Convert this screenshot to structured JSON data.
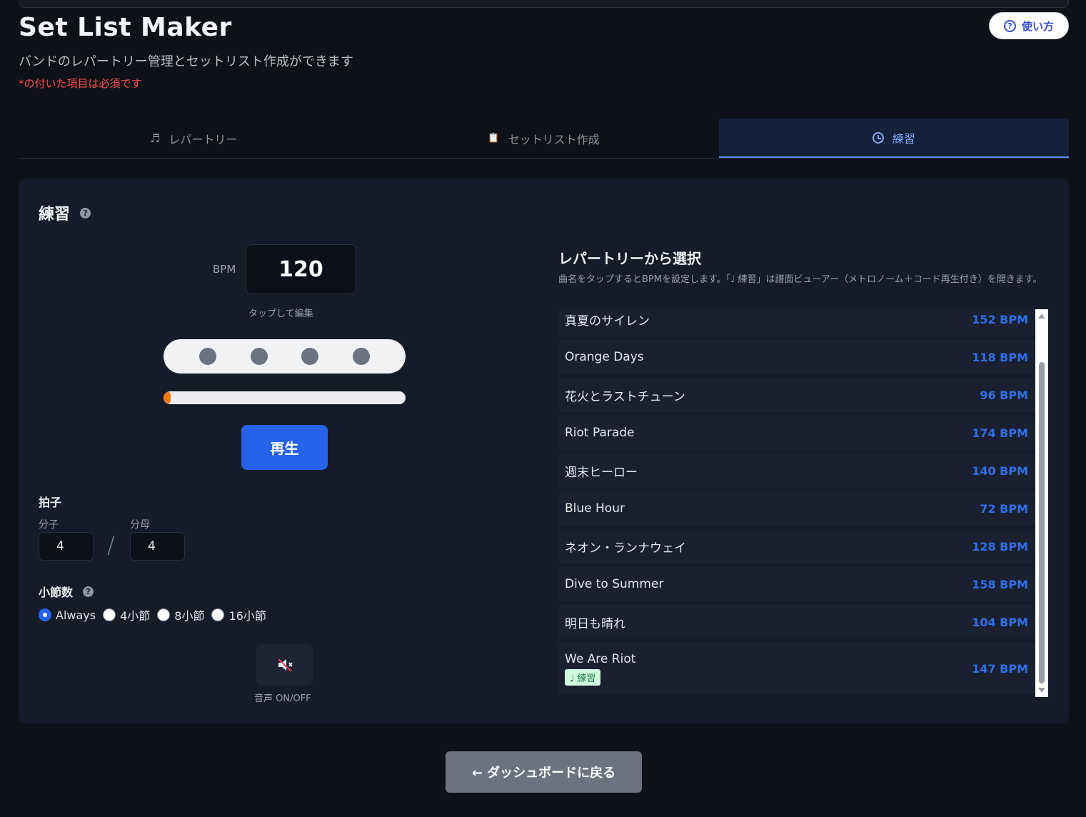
{
  "header": {
    "title": "Set List Maker",
    "subtitle": "バンドのレパートリー管理とセットリスト作成ができます",
    "required_note": "*の付いた項目は必須です",
    "help_button": "使い方",
    "help_icon": "?"
  },
  "tabs": [
    {
      "label": "レパートリー",
      "icon": "music-note-icon",
      "glyph": "♬",
      "active": false
    },
    {
      "label": "セットリスト作成",
      "icon": "clipboard-icon",
      "glyph": "📋",
      "active": false
    },
    {
      "label": "練習",
      "icon": "clock-icon",
      "active": true
    }
  ],
  "practice": {
    "title": "練習",
    "help_glyph": "?",
    "bpm_label": "BPM",
    "bpm_value": "120",
    "bpm_hint": "タップして編集",
    "beat_count": 4,
    "progress_percent": 3,
    "play_button": "再生",
    "time_signature": {
      "title": "拍子",
      "numerator_label": "分子",
      "denominator_label": "分母",
      "numerator": "4",
      "denominator": "4",
      "separator": "/"
    },
    "bars": {
      "title": "小節数",
      "options": [
        "Always",
        "4小節",
        "8小節",
        "16小節"
      ],
      "selected": "Always"
    },
    "sound_toggle_label": "音声 ON/OFF",
    "sound_icon": "mute-speaker-icon"
  },
  "repertoire": {
    "title": "レパートリーから選択",
    "description": "曲名をタップするとBPMを設定します。「♩ 練習」は譜面ビューアー（メトロノーム＋コード再生付き）を開きます。",
    "songs": [
      {
        "name": "真夏のサイレン",
        "bpm": "152 BPM"
      },
      {
        "name": "Orange Days",
        "bpm": "118 BPM"
      },
      {
        "name": "花火とラストチューン",
        "bpm": "96 BPM"
      },
      {
        "name": "Riot Parade",
        "bpm": "174 BPM"
      },
      {
        "name": "週末ヒーロー",
        "bpm": "140 BPM"
      },
      {
        "name": "Blue Hour",
        "bpm": "72 BPM"
      },
      {
        "name": "ネオン・ランナウェイ",
        "bpm": "128 BPM"
      },
      {
        "name": "Dive to Summer",
        "bpm": "158 BPM"
      },
      {
        "name": "明日も晴れ",
        "bpm": "104 BPM"
      },
      {
        "name": "We Are Riot",
        "bpm": "147 BPM",
        "badge": "♩ 練習"
      }
    ]
  },
  "footer": {
    "back_button": "← ダッシュボードに戻る"
  },
  "colors": {
    "accent": "#2563eb",
    "bpm_text": "#2f6fe8",
    "required": "#ff4b4b",
    "progress": "#f07a18"
  }
}
